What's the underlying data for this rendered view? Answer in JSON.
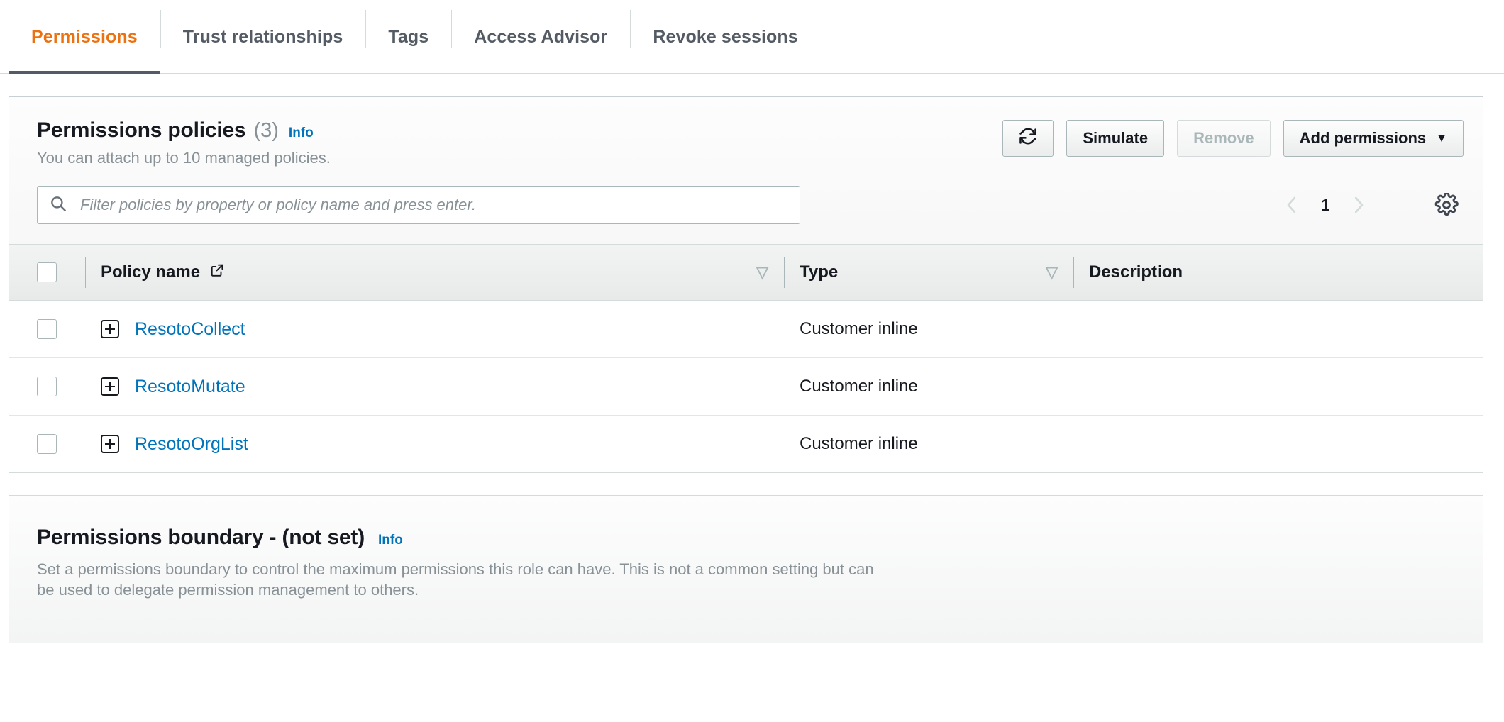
{
  "tabs": [
    {
      "label": "Permissions",
      "active": true
    },
    {
      "label": "Trust relationships",
      "active": false
    },
    {
      "label": "Tags",
      "active": false
    },
    {
      "label": "Access Advisor",
      "active": false
    },
    {
      "label": "Revoke sessions",
      "active": false
    }
  ],
  "policies_panel": {
    "title": "Permissions policies",
    "count": "(3)",
    "info_label": "Info",
    "subtitle": "You can attach up to 10 managed policies.",
    "actions": {
      "refresh_label": "",
      "refresh_icon": "refresh-icon",
      "simulate_label": "Simulate",
      "remove_label": "Remove",
      "add_permissions_label": "Add permissions",
      "add_permissions_caret": "▼"
    },
    "search": {
      "placeholder": "Filter policies by property or policy name and press enter.",
      "value": "",
      "icon": "search-icon"
    },
    "pagination": {
      "prev_icon": "chevron-left-icon",
      "page": "1",
      "next_icon": "chevron-right-icon",
      "settings_icon": "gear-icon"
    },
    "table": {
      "columns": [
        {
          "label": "Policy name",
          "icon": "external-link-icon",
          "sortable": true
        },
        {
          "label": "Type",
          "sortable": true
        },
        {
          "label": "Description",
          "sortable": false
        }
      ],
      "rows": [
        {
          "name": "ResotoCollect",
          "type": "Customer inline",
          "description": "",
          "expand_icon": "plus-box-icon"
        },
        {
          "name": "ResotoMutate",
          "type": "Customer inline",
          "description": "",
          "expand_icon": "plus-box-icon"
        },
        {
          "name": "ResotoOrgList",
          "type": "Customer inline",
          "description": "",
          "expand_icon": "plus-box-icon"
        }
      ]
    }
  },
  "boundary_panel": {
    "title": "Permissions boundary - (not set)",
    "info_label": "Info",
    "description": "Set a permissions boundary to control the maximum permissions this role can have. This is not a common setting but can be used to delegate permission management to others."
  },
  "colors": {
    "accent_orange": "#ec7211",
    "link_blue": "#0073bb",
    "text_dark": "#16191f",
    "text_muted": "#879196",
    "border": "#d5dbdb"
  }
}
